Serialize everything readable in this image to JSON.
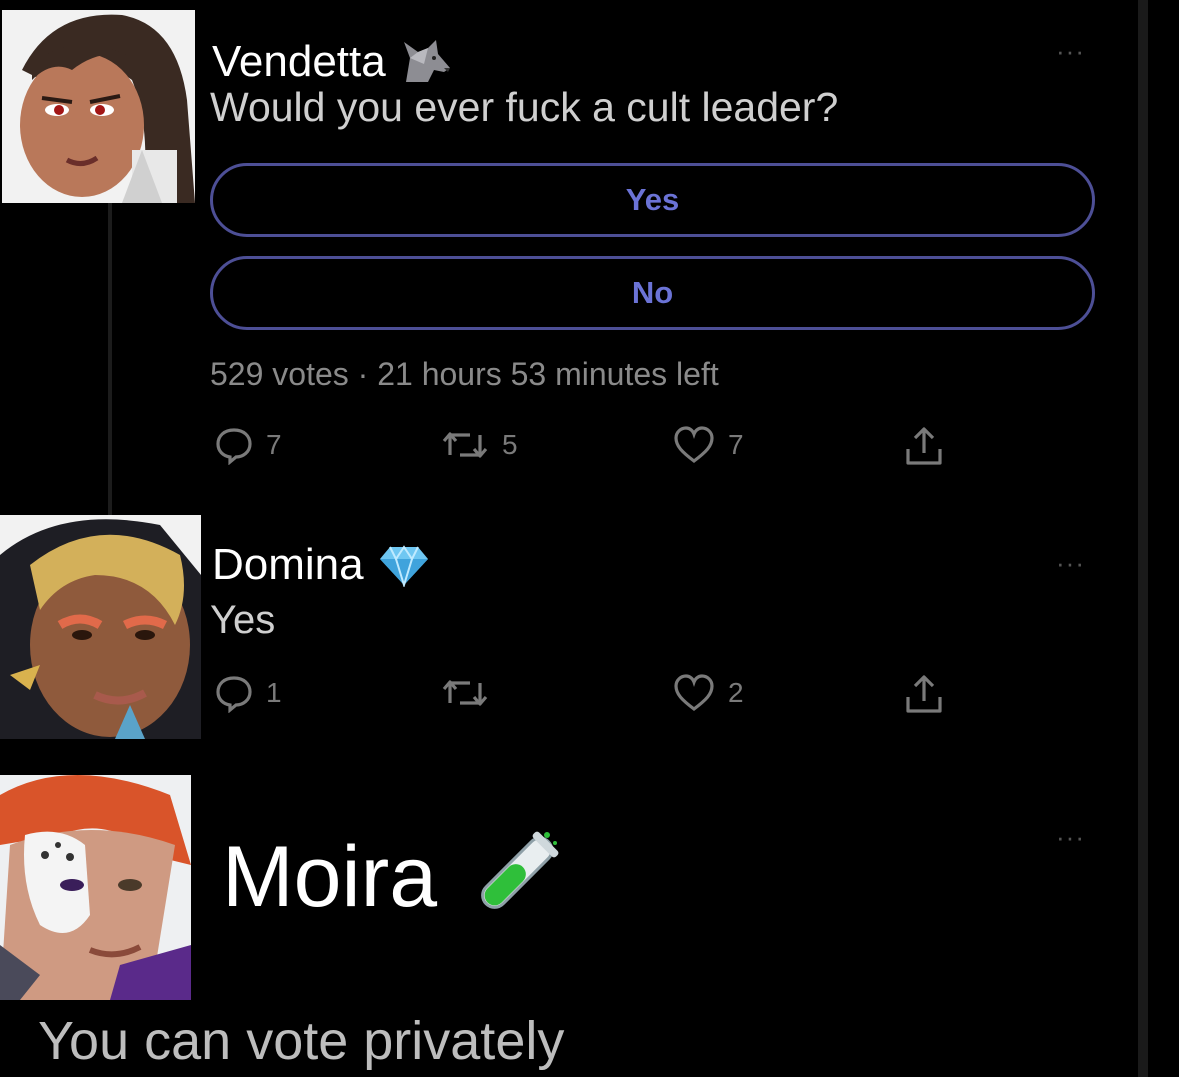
{
  "posts": [
    {
      "name": "Vendetta",
      "badge_icon": "wolf-icon",
      "text": "Would you ever fuck a cult leader?",
      "poll": {
        "options": [
          "Yes",
          "No"
        ],
        "votes": "529 votes",
        "separator": "·",
        "time_left": "21 hours 53 minutes left"
      },
      "actions": {
        "replies": "7",
        "retweets": "5",
        "likes": "7"
      }
    },
    {
      "name": "Domina",
      "badge_icon": "diamond-icon",
      "text": "Yes",
      "actions": {
        "replies": "1",
        "retweets": "",
        "likes": "2"
      }
    },
    {
      "name": "Moira",
      "badge_icon": "test-tube-icon",
      "text": "You can vote privately"
    }
  ],
  "more_label": "···",
  "colors": {
    "background": "#000000",
    "poll_accent": "#6b73d6",
    "poll_border": "#4d4f96",
    "muted": "#8a8a8a"
  }
}
